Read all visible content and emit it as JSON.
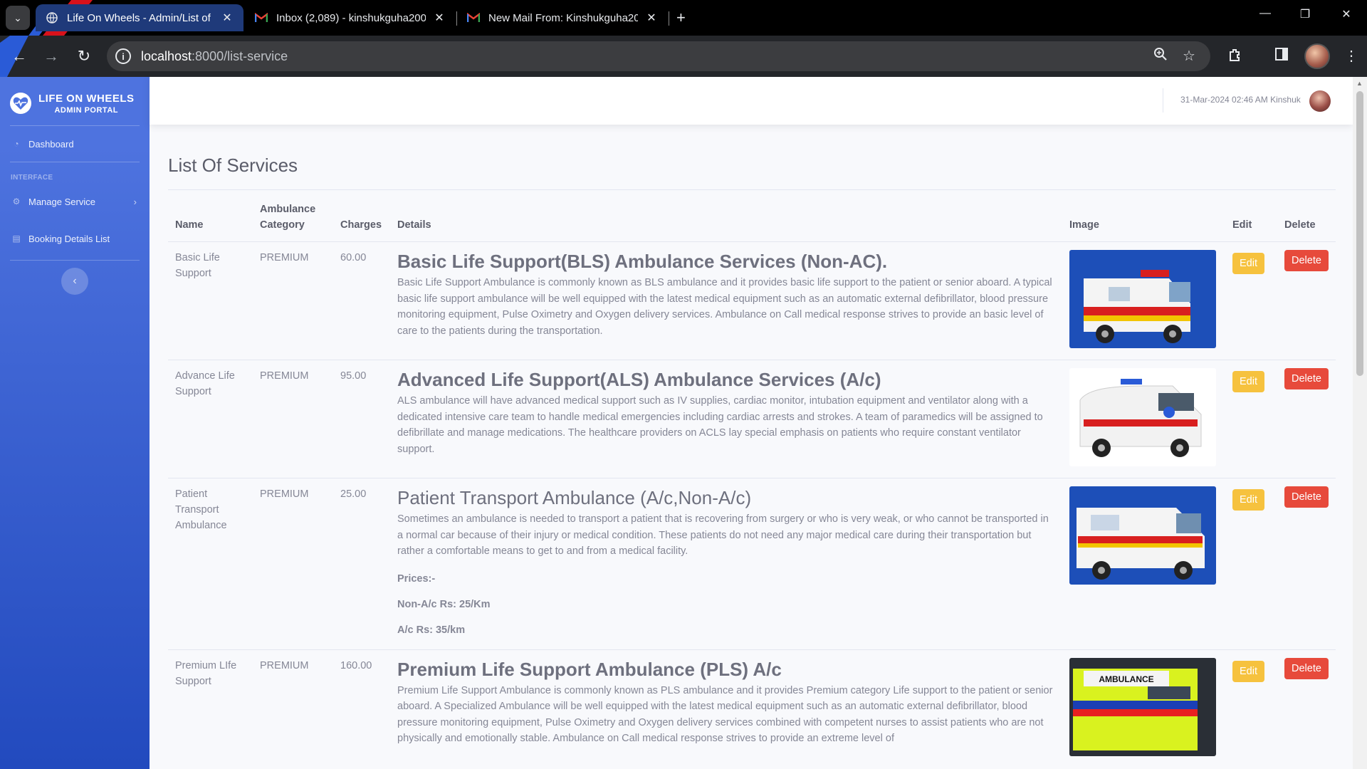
{
  "browser": {
    "tabs": [
      {
        "title": "Life On Wheels - Admin/List of",
        "close": "✕"
      },
      {
        "title": "Inbox (2,089) - kinshukguha200",
        "close": "✕"
      },
      {
        "title": "New Mail From: Kinshukguha20",
        "close": "✕"
      }
    ],
    "new_tab": "+",
    "url_host": "localhost",
    "url_path": ":8000/list-service",
    "window_controls": [
      "—",
      "❐",
      "✕"
    ]
  },
  "sidebar": {
    "brand_title": "LIFE ON WHEELS",
    "brand_subtitle": "ADMIN PORTAL",
    "dashboard": "Dashboard",
    "heading": "INTERFACE",
    "manage_service": "Manage Service",
    "booking_details": "Booking Details List",
    "icons": {
      "dashboard": "gauge-icon",
      "manage": "gear-icon",
      "booking": "list-icon",
      "toggle": "chevron-left-icon"
    }
  },
  "topbar": {
    "user_info": "31-Mar-2024 02:46 AM Kinshuk"
  },
  "main": {
    "title": "List Of Services",
    "columns": {
      "name": "Name",
      "category": "Ambulance Category",
      "charges": "Charges",
      "details": "Details",
      "image": "Image",
      "edit": "Edit",
      "delete": "Delete"
    },
    "rows": [
      {
        "name": "Basic Life Support",
        "category": "PREMIUM",
        "charges": "60.00",
        "title": "Basic Life Support(BLS) Ambulance Services (Non-AC).",
        "text": "Basic Life Support Ambulance is commonly known as BLS ambulance and it provides basic life support to the patient or senior aboard. A typical basic life support ambulance will be well equipped with the latest medical equipment such as an automatic external defibrillator, blood pressure monitoring equipment, Pulse Oximetry and Oxygen delivery services. Ambulance on Call medical response strives to provide an basic level of care to the patients during the transportation.",
        "edit": "Edit",
        "delete": "Delete"
      },
      {
        "name": "Advance Life Support",
        "category": "PREMIUM",
        "charges": "95.00",
        "title": "Advanced Life Support(ALS) Ambulance Services (A/c)",
        "text": "ALS ambulance will have advanced medical support such as IV supplies, cardiac monitor, intubation equipment and ventilator along with a dedicated intensive care team to handle medical emergencies including cardiac arrests and strokes. A team of paramedics will be assigned to defibrillate and manage medications. The healthcare providers on ACLS lay special emphasis on patients who require constant ventilator support.",
        "edit": "Edit",
        "delete": "Delete"
      },
      {
        "name": "Patient Transport Ambulance",
        "category": "PREMIUM",
        "charges": "25.00",
        "title": "Patient Transport Ambulance (A/c,Non-A/c)",
        "text": "Sometimes an ambulance is needed to transport a patient that is recovering from surgery or who is very weak, or who cannot be transported in a normal car because of their injury or medical condition. These patients do not need any major medical care during their transportation but rather a comfortable means to get to and from a medical facility.",
        "prices_label": "Prices:-",
        "price_nonac": "Non-A/c Rs: 25/Km",
        "price_ac": "A/c Rs: 35/km",
        "edit": "Edit",
        "delete": "Delete"
      },
      {
        "name": "Premium LIfe Support",
        "category": "PREMIUM",
        "charges": "160.00",
        "title": "Premium Life Support Ambulance (PLS) A/c",
        "text": "Premium Life Support Ambulance is commonly known as PLS ambulance and it provides Premium category Life support to the patient or senior aboard. A Specialized Ambulance will be well equipped with the latest medical equipment such as an automatic external defibrillator, blood pressure monitoring equipment, Pulse Oximetry and Oxygen delivery services combined with competent nurses to assist patients who are not physically and emotionally stable. Ambulance on Call medical response strives to provide an extreme level of",
        "image_label": "AMBULANCE",
        "edit": "Edit",
        "delete": "Delete"
      }
    ]
  },
  "colors": {
    "sidebar": "#4e73df",
    "edit_button": "#f6c23e",
    "delete_button": "#e74a3b",
    "active_tab": "#1f3a7a"
  }
}
